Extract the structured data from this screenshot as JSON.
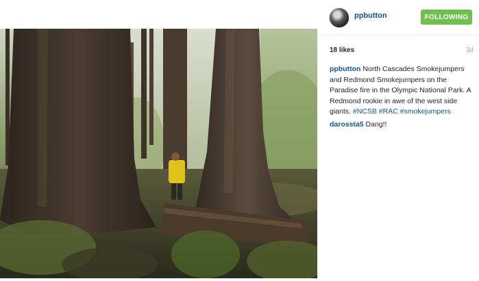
{
  "post": {
    "username": "ppbutton",
    "follow_label": "FOLLOWING",
    "likes": "18 likes",
    "age": "3d",
    "caption": {
      "user": "ppbutton",
      "text": " North Cascades Smokejumpers and Redmond Smokejumpers on the Paradise fire in the Olympic National Park. A Redmond rookie in awe of the west side giants. ",
      "hashtags": [
        "#NCSB",
        "#RAC",
        "#smokejumpers"
      ]
    },
    "comments": [
      {
        "user": "darossta5",
        "text": " Dang!!"
      }
    ]
  },
  "colors": {
    "link": "#125688",
    "follow_bg": "#70c050",
    "muted": "#a5a7aa"
  },
  "icons": {
    "avatar": "profile-photo"
  }
}
